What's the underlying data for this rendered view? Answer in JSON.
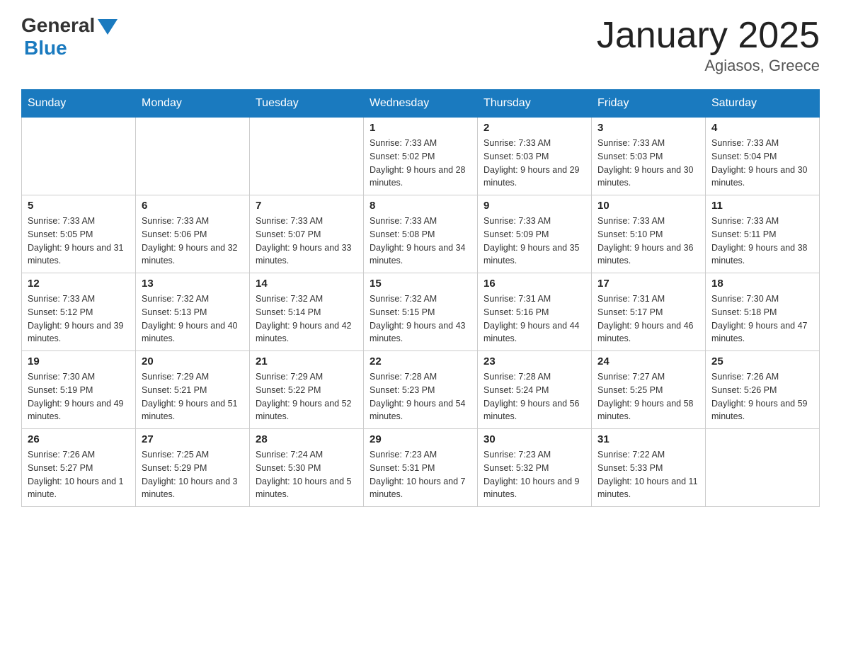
{
  "header": {
    "logo_general": "General",
    "logo_blue": "Blue",
    "title": "January 2025",
    "subtitle": "Agiasos, Greece"
  },
  "days_of_week": [
    "Sunday",
    "Monday",
    "Tuesday",
    "Wednesday",
    "Thursday",
    "Friday",
    "Saturday"
  ],
  "weeks": [
    [
      {
        "day": "",
        "sunrise": "",
        "sunset": "",
        "daylight": ""
      },
      {
        "day": "",
        "sunrise": "",
        "sunset": "",
        "daylight": ""
      },
      {
        "day": "",
        "sunrise": "",
        "sunset": "",
        "daylight": ""
      },
      {
        "day": "1",
        "sunrise": "Sunrise: 7:33 AM",
        "sunset": "Sunset: 5:02 PM",
        "daylight": "Daylight: 9 hours and 28 minutes."
      },
      {
        "day": "2",
        "sunrise": "Sunrise: 7:33 AM",
        "sunset": "Sunset: 5:03 PM",
        "daylight": "Daylight: 9 hours and 29 minutes."
      },
      {
        "day": "3",
        "sunrise": "Sunrise: 7:33 AM",
        "sunset": "Sunset: 5:03 PM",
        "daylight": "Daylight: 9 hours and 30 minutes."
      },
      {
        "day": "4",
        "sunrise": "Sunrise: 7:33 AM",
        "sunset": "Sunset: 5:04 PM",
        "daylight": "Daylight: 9 hours and 30 minutes."
      }
    ],
    [
      {
        "day": "5",
        "sunrise": "Sunrise: 7:33 AM",
        "sunset": "Sunset: 5:05 PM",
        "daylight": "Daylight: 9 hours and 31 minutes."
      },
      {
        "day": "6",
        "sunrise": "Sunrise: 7:33 AM",
        "sunset": "Sunset: 5:06 PM",
        "daylight": "Daylight: 9 hours and 32 minutes."
      },
      {
        "day": "7",
        "sunrise": "Sunrise: 7:33 AM",
        "sunset": "Sunset: 5:07 PM",
        "daylight": "Daylight: 9 hours and 33 minutes."
      },
      {
        "day": "8",
        "sunrise": "Sunrise: 7:33 AM",
        "sunset": "Sunset: 5:08 PM",
        "daylight": "Daylight: 9 hours and 34 minutes."
      },
      {
        "day": "9",
        "sunrise": "Sunrise: 7:33 AM",
        "sunset": "Sunset: 5:09 PM",
        "daylight": "Daylight: 9 hours and 35 minutes."
      },
      {
        "day": "10",
        "sunrise": "Sunrise: 7:33 AM",
        "sunset": "Sunset: 5:10 PM",
        "daylight": "Daylight: 9 hours and 36 minutes."
      },
      {
        "day": "11",
        "sunrise": "Sunrise: 7:33 AM",
        "sunset": "Sunset: 5:11 PM",
        "daylight": "Daylight: 9 hours and 38 minutes."
      }
    ],
    [
      {
        "day": "12",
        "sunrise": "Sunrise: 7:33 AM",
        "sunset": "Sunset: 5:12 PM",
        "daylight": "Daylight: 9 hours and 39 minutes."
      },
      {
        "day": "13",
        "sunrise": "Sunrise: 7:32 AM",
        "sunset": "Sunset: 5:13 PM",
        "daylight": "Daylight: 9 hours and 40 minutes."
      },
      {
        "day": "14",
        "sunrise": "Sunrise: 7:32 AM",
        "sunset": "Sunset: 5:14 PM",
        "daylight": "Daylight: 9 hours and 42 minutes."
      },
      {
        "day": "15",
        "sunrise": "Sunrise: 7:32 AM",
        "sunset": "Sunset: 5:15 PM",
        "daylight": "Daylight: 9 hours and 43 minutes."
      },
      {
        "day": "16",
        "sunrise": "Sunrise: 7:31 AM",
        "sunset": "Sunset: 5:16 PM",
        "daylight": "Daylight: 9 hours and 44 minutes."
      },
      {
        "day": "17",
        "sunrise": "Sunrise: 7:31 AM",
        "sunset": "Sunset: 5:17 PM",
        "daylight": "Daylight: 9 hours and 46 minutes."
      },
      {
        "day": "18",
        "sunrise": "Sunrise: 7:30 AM",
        "sunset": "Sunset: 5:18 PM",
        "daylight": "Daylight: 9 hours and 47 minutes."
      }
    ],
    [
      {
        "day": "19",
        "sunrise": "Sunrise: 7:30 AM",
        "sunset": "Sunset: 5:19 PM",
        "daylight": "Daylight: 9 hours and 49 minutes."
      },
      {
        "day": "20",
        "sunrise": "Sunrise: 7:29 AM",
        "sunset": "Sunset: 5:21 PM",
        "daylight": "Daylight: 9 hours and 51 minutes."
      },
      {
        "day": "21",
        "sunrise": "Sunrise: 7:29 AM",
        "sunset": "Sunset: 5:22 PM",
        "daylight": "Daylight: 9 hours and 52 minutes."
      },
      {
        "day": "22",
        "sunrise": "Sunrise: 7:28 AM",
        "sunset": "Sunset: 5:23 PM",
        "daylight": "Daylight: 9 hours and 54 minutes."
      },
      {
        "day": "23",
        "sunrise": "Sunrise: 7:28 AM",
        "sunset": "Sunset: 5:24 PM",
        "daylight": "Daylight: 9 hours and 56 minutes."
      },
      {
        "day": "24",
        "sunrise": "Sunrise: 7:27 AM",
        "sunset": "Sunset: 5:25 PM",
        "daylight": "Daylight: 9 hours and 58 minutes."
      },
      {
        "day": "25",
        "sunrise": "Sunrise: 7:26 AM",
        "sunset": "Sunset: 5:26 PM",
        "daylight": "Daylight: 9 hours and 59 minutes."
      }
    ],
    [
      {
        "day": "26",
        "sunrise": "Sunrise: 7:26 AM",
        "sunset": "Sunset: 5:27 PM",
        "daylight": "Daylight: 10 hours and 1 minute."
      },
      {
        "day": "27",
        "sunrise": "Sunrise: 7:25 AM",
        "sunset": "Sunset: 5:29 PM",
        "daylight": "Daylight: 10 hours and 3 minutes."
      },
      {
        "day": "28",
        "sunrise": "Sunrise: 7:24 AM",
        "sunset": "Sunset: 5:30 PM",
        "daylight": "Daylight: 10 hours and 5 minutes."
      },
      {
        "day": "29",
        "sunrise": "Sunrise: 7:23 AM",
        "sunset": "Sunset: 5:31 PM",
        "daylight": "Daylight: 10 hours and 7 minutes."
      },
      {
        "day": "30",
        "sunrise": "Sunrise: 7:23 AM",
        "sunset": "Sunset: 5:32 PM",
        "daylight": "Daylight: 10 hours and 9 minutes."
      },
      {
        "day": "31",
        "sunrise": "Sunrise: 7:22 AM",
        "sunset": "Sunset: 5:33 PM",
        "daylight": "Daylight: 10 hours and 11 minutes."
      },
      {
        "day": "",
        "sunrise": "",
        "sunset": "",
        "daylight": ""
      }
    ]
  ]
}
